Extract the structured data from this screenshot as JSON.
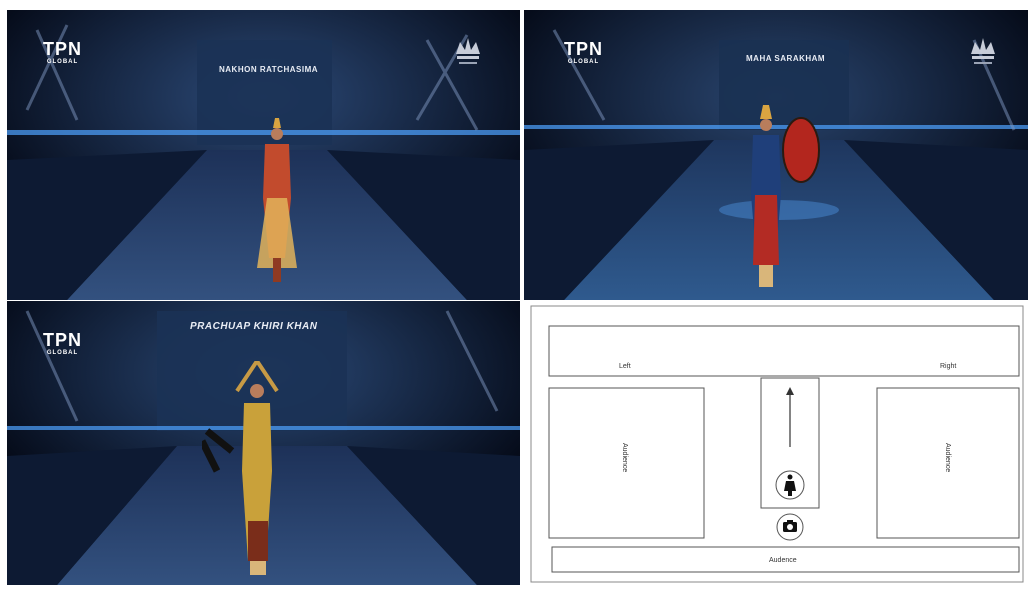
{
  "panels": [
    {
      "logo_main": "TPN",
      "logo_sub": "GLOBAL",
      "caption": "NAKHON RATCHASIMA"
    },
    {
      "logo_main": "TPN",
      "logo_sub": "GLOBAL",
      "caption": "MAHA SARAKHAM"
    },
    {
      "logo_main": "TPN",
      "logo_sub": "GLOBAL",
      "caption": "PRACHUAP KHIRI KHAN"
    }
  ],
  "diagram": {
    "top_left_label": "Left",
    "top_right_label": "Right",
    "left_block_label": "Audience",
    "right_block_label": "Audience",
    "bottom_label": "Audence",
    "icons": [
      "up-arrow-icon",
      "person-icon",
      "camera-icon"
    ]
  },
  "colors": {
    "stage_dark": "#050b1c",
    "runway_blue": "#3a5a8c",
    "light_blue": "#5aa6ff",
    "diagram_line": "#555555"
  }
}
